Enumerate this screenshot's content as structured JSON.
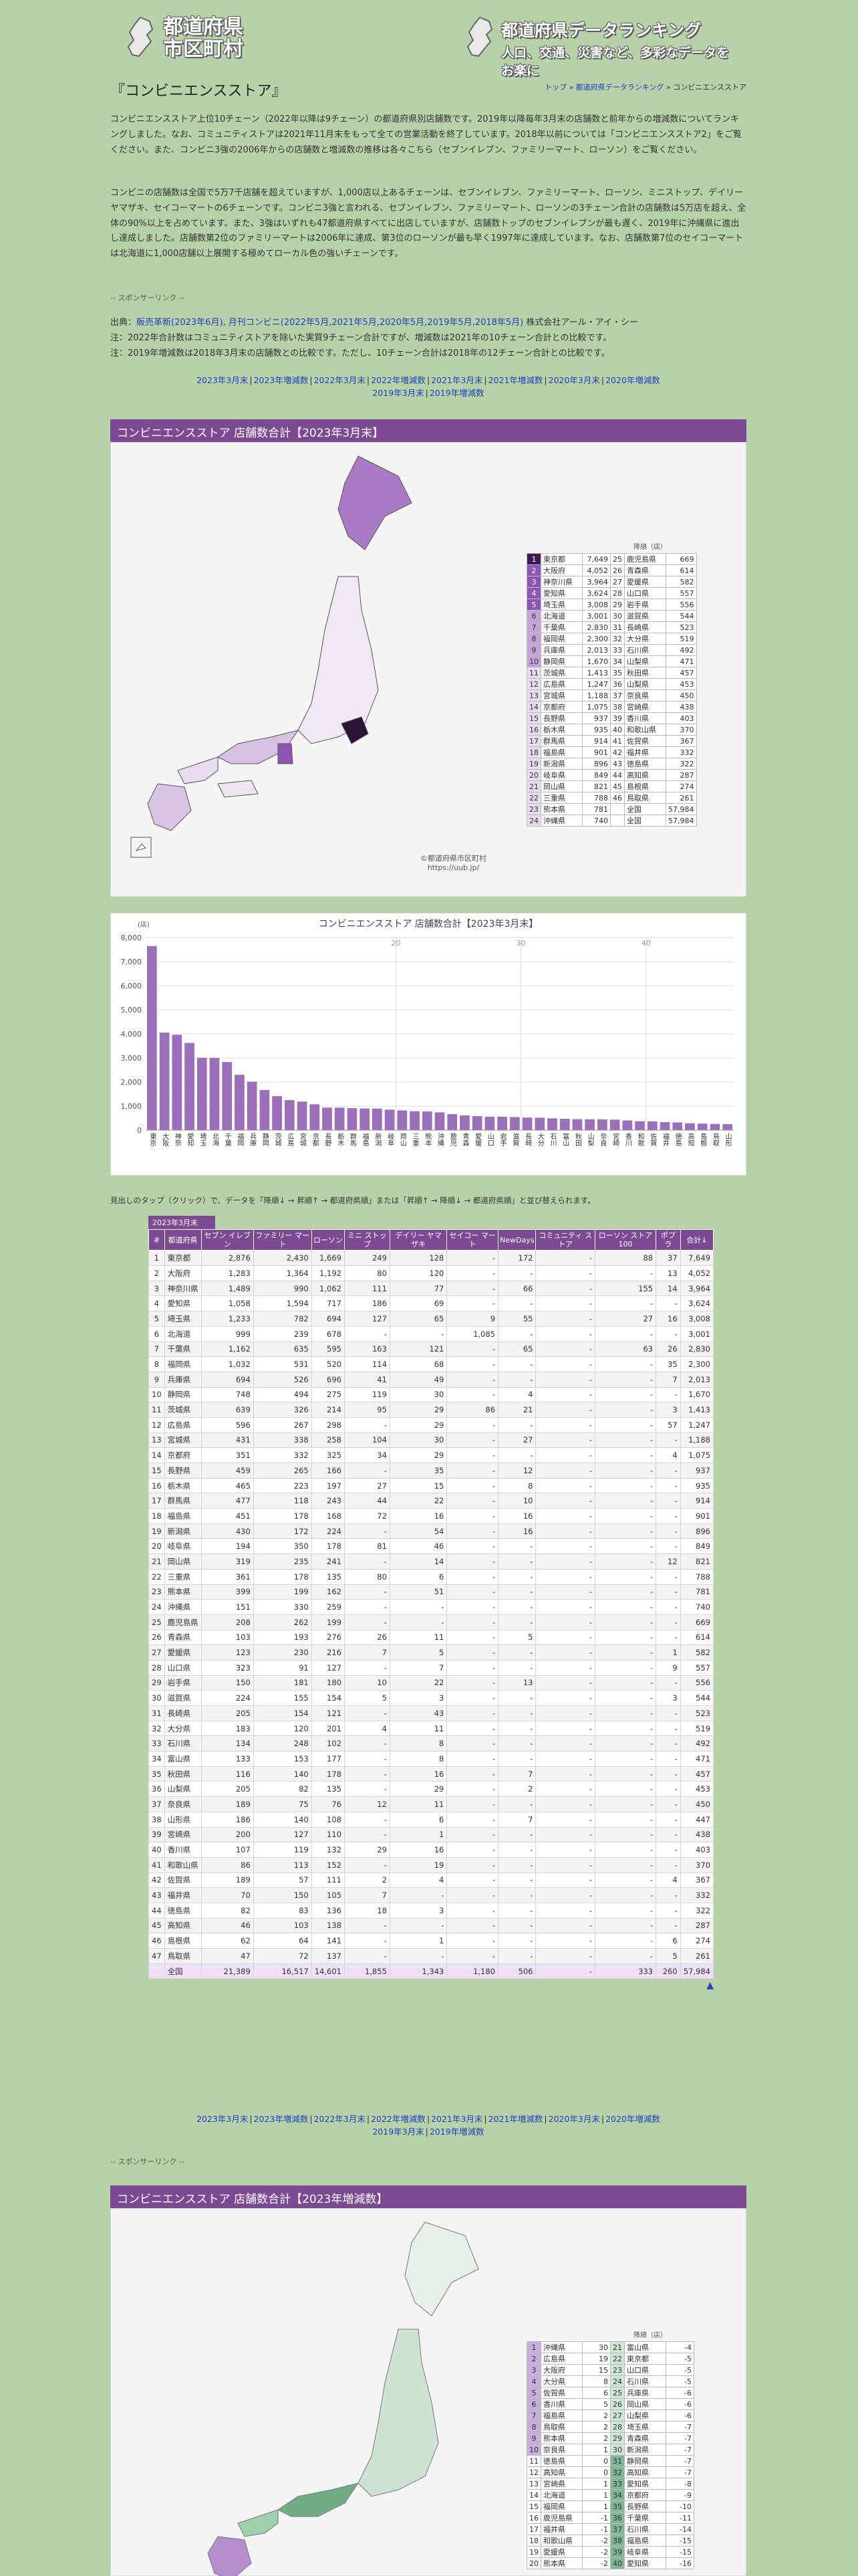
{
  "site": {
    "logo_left": [
      "都道府県",
      "市区町村"
    ],
    "logo_right_1": "都道府県データランキング",
    "logo_right_2": "人口、交通、災害など、多彩なデータをお楽に"
  },
  "page_title": "『コンビニエンスストア』",
  "breadcrumb": {
    "top": "トップ",
    "sep": " » ",
    "mid": "都道府県データランキング",
    "current": "コンビニエンスストア"
  },
  "intro1": "コンビニエンスストア上位10チェーン（2022年以降は9チェーン）の都道府県別店舗数です。2019年以降毎年3月末の店舗数と前年からの増減数についてランキングしました。なお、コミュニティストアは2021年11月末をもって全ての営業活動を終了しています。2018年以前については「コンビニエンスストア2」をご覧ください。また、コンビニ3強の2006年からの店舗数と増減数の推移は各々こちら（セブンイレブン、ファミリーマート、ローソン）をご覧ください。",
  "intro2": "コンビニの店舗数は全国で5万7千店舗を超えていますが、1,000店以上あるチェーンは、セブンイレブン、ファミリーマート、ローソン、ミニストップ、デイリーヤマザキ、セイコーマートの6チェーンです。コンビニ3強と言われる、セブンイレブン、ファミリーマート、ローソンの3チェーン合計の店舗数は5万店を超え、全体の90%以上を占めています。また、3強はいずれも47都道府県すべてに出店していますが、店舗数トップのセブンイレブンが最も遅く、2019年に沖縄県に進出し達成しました。店舗数第2位のファミリーマートは2006年に達成、第3位のローソンが最も早く1997年に達成しています。なお、店舗数第7位のセイコーマートは北海道に1,000店舗以上展開する極めてローカル色の強いチェーンです。",
  "sponsor": "-- スポンサーリンク --",
  "source_prefix": "出典：",
  "source_link": "販売革新(2023年6月), 月刊コンビニ(2022年5月,2021年5月,2020年5月,2019年5月,2018年5月)",
  "source_suffix": " 株式会社アール・アイ・シー",
  "note1": "注：2022年合計数はコミュニティストアを除いた実質9チェーン合計ですが、増減数は2021年の10チェーン合計との比較です。",
  "note2": "注：2019年増減数は2018年3月末の店舗数との比較です。ただし、10チェーン合計は2018年の12チェーン合計との比較です。",
  "links": [
    "2023年3月末",
    "2023年増減数",
    "2022年3月末",
    "2022年増減数",
    "2021年3月末",
    "2021年増減数",
    "2020年3月末",
    "2020年増減数",
    "2019年3月末",
    "2019年増減数"
  ],
  "section1_title": "コンビニエンスストア 店舗数合計【2023年3月末】",
  "section2_title": "コンビニエンスストア 店舗数合計【2023年増減数】",
  "map_legend_note": "降順（店）",
  "map_credit": [
    "©都道府県市区町村",
    "https://uub.jp/"
  ],
  "map1_total_label": "全国",
  "map1_total": "57,984",
  "rank1": [
    [
      "東京都",
      "7,649"
    ],
    [
      "大阪府",
      "4,052"
    ],
    [
      "神奈川県",
      "3,964"
    ],
    [
      "愛知県",
      "3,624"
    ],
    [
      "埼玉県",
      "3,008"
    ],
    [
      "北海道",
      "3,001"
    ],
    [
      "千葉県",
      "2,830"
    ],
    [
      "福岡県",
      "2,300"
    ],
    [
      "兵庫県",
      "2,013"
    ],
    [
      "静岡県",
      "1,670"
    ],
    [
      "茨城県",
      "1,413"
    ],
    [
      "広島県",
      "1,247"
    ],
    [
      "宮城県",
      "1,188"
    ],
    [
      "京都府",
      "1,075"
    ],
    [
      "長野県",
      "937"
    ],
    [
      "栃木県",
      "935"
    ],
    [
      "群馬県",
      "914"
    ],
    [
      "福島県",
      "901"
    ],
    [
      "新潟県",
      "896"
    ],
    [
      "岐阜県",
      "849"
    ],
    [
      "岡山県",
      "821"
    ],
    [
      "三重県",
      "788"
    ],
    [
      "熊本県",
      "781"
    ],
    [
      "沖縄県",
      "740"
    ],
    [
      "鹿児島県",
      "669"
    ],
    [
      "青森県",
      "614"
    ],
    [
      "愛媛県",
      "582"
    ],
    [
      "山口県",
      "557"
    ],
    [
      "岩手県",
      "556"
    ],
    [
      "滋賀県",
      "544"
    ],
    [
      "長崎県",
      "523"
    ],
    [
      "大分県",
      "519"
    ],
    [
      "石川県",
      "492"
    ],
    [
      "山梨県",
      "471"
    ],
    [
      "秋田県",
      "457"
    ],
    [
      "山梨県",
      "453"
    ],
    [
      "奈良県",
      "450"
    ],
    [
      "宮崎県",
      "438"
    ],
    [
      "香川県",
      "403"
    ],
    [
      "和歌山県",
      "370"
    ],
    [
      "佐賀県",
      "367"
    ],
    [
      "福井県",
      "332"
    ],
    [
      "徳島県",
      "322"
    ],
    [
      "高知県",
      "287"
    ],
    [
      "島根県",
      "274"
    ],
    [
      "鳥取県",
      "261"
    ]
  ],
  "rank2": [
    [
      "沖縄県",
      "30"
    ],
    [
      "広島県",
      "19"
    ],
    [
      "大阪府",
      "15"
    ],
    [
      "大分県",
      "8"
    ],
    [
      "佐賀県",
      "6"
    ],
    [
      "香川県",
      "5"
    ],
    [
      "福島県",
      "2"
    ],
    [
      "鳥取県",
      "2"
    ],
    [
      "熊本県",
      "2"
    ],
    [
      "奈良県",
      "1"
    ],
    [
      "徳島県",
      "0"
    ],
    [
      "高知県",
      "0"
    ],
    [
      "宮崎県",
      "1"
    ],
    [
      "北海道",
      "1"
    ],
    [
      "福岡県",
      "1"
    ],
    [
      "鹿児島県",
      "-1"
    ],
    [
      "福井県",
      "-1"
    ],
    [
      "和歌山県",
      "-2"
    ],
    [
      "愛媛県",
      "-2"
    ],
    [
      "熊本県",
      "-2"
    ],
    [
      "富山県",
      "-4"
    ],
    [
      "東京都",
      "-5"
    ],
    [
      "山口県",
      "-5"
    ],
    [
      "石川県",
      "-5"
    ],
    [
      "兵庫県",
      "-6"
    ],
    [
      "岡山県",
      "-6"
    ],
    [
      "山梨県",
      "-6"
    ],
    [
      "埼玉県",
      "-7"
    ],
    [
      "青森県",
      "-7"
    ],
    [
      "新潟県",
      "-7"
    ],
    [
      "静岡県",
      "-7"
    ],
    [
      "高知県",
      "-7"
    ],
    [
      "愛知県",
      "-8"
    ],
    [
      "京都府",
      "-9"
    ],
    [
      "長野県",
      "-10"
    ],
    [
      "千葉県",
      "-11"
    ],
    [
      "石川県",
      "-14"
    ],
    [
      "福島県",
      "-15"
    ],
    [
      "岐阜県",
      "-15"
    ],
    [
      "愛知県",
      "-16"
    ]
  ],
  "chart1": {
    "chart_data": {
      "type": "bar",
      "title": "コンビニエンスストア 店舗数合計【2023年3月末】",
      "ylabel": "(店)",
      "ylim": [
        0,
        8000
      ],
      "yticks": [
        "0",
        "1,000",
        "2,000",
        "3,000",
        "4,000",
        "5,000",
        "6,000",
        "7,000",
        "8,000"
      ],
      "topticks": [
        "20",
        "30",
        "40"
      ],
      "categories": [
        "東京",
        "大阪",
        "神奈",
        "愛知",
        "埼玉",
        "北海",
        "千葉",
        "福岡",
        "兵庫",
        "静岡",
        "茨城",
        "広島",
        "宮城",
        "京都",
        "長野",
        "栃木",
        "群馬",
        "福島",
        "新潟",
        "岐阜",
        "岡山",
        "三重",
        "熊本",
        "沖縄",
        "鹿児",
        "青森",
        "愛媛",
        "山口",
        "岩手",
        "滋賀",
        "長崎",
        "大分",
        "石川",
        "富山",
        "秋田",
        "山梨",
        "奈良",
        "宮崎",
        "香川",
        "和歌",
        "佐賀",
        "福井",
        "徳島",
        "高知",
        "島根",
        "鳥取",
        "山形"
      ],
      "values": [
        7649,
        4052,
        3964,
        3624,
        3008,
        3001,
        2830,
        2300,
        2013,
        1670,
        1413,
        1247,
        1188,
        1075,
        937,
        935,
        914,
        901,
        896,
        849,
        821,
        788,
        781,
        740,
        669,
        614,
        582,
        557,
        556,
        544,
        523,
        519,
        492,
        471,
        457,
        453,
        450,
        438,
        403,
        370,
        367,
        332,
        322,
        287,
        274,
        261,
        250
      ],
      "colors": {
        "bar": "#9b6fb9",
        "grid": "#dddddd"
      }
    }
  },
  "table_intro": "見出しのタップ（クリック）で、データを「降順↓ → 昇順↑ → 都道府県順」または「昇順↑ → 降順↓ → 都道府県順」と並び替えられます。",
  "table_caption": "2023年3月末",
  "table_headers": [
    "#",
    "都道府県",
    "セブン イレブン",
    "ファミリー マート",
    "ローソン",
    "ミニ ストップ",
    "デイリー ヤマザキ",
    "セイコー マート",
    "NewDays",
    "コミュニティ ストア",
    "ローソン ストア100",
    "ポプラ",
    "合計↓"
  ],
  "table_rows": [
    [
      "1",
      "東京都",
      "2,876",
      "2,430",
      "1,669",
      "249",
      "128",
      "-",
      "172",
      "-",
      "88",
      "37",
      "7,649"
    ],
    [
      "2",
      "大阪府",
      "1,283",
      "1,364",
      "1,192",
      "80",
      "120",
      "-",
      "-",
      "-",
      "-",
      "13",
      "4,052"
    ],
    [
      "3",
      "神奈川県",
      "1,489",
      "990",
      "1,062",
      "111",
      "77",
      "-",
      "66",
      "-",
      "155",
      "14",
      "3,964"
    ],
    [
      "4",
      "愛知県",
      "1,058",
      "1,594",
      "717",
      "186",
      "69",
      "-",
      "-",
      "-",
      "-",
      "-",
      "3,624"
    ],
    [
      "5",
      "埼玉県",
      "1,233",
      "782",
      "694",
      "127",
      "65",
      "9",
      "55",
      "-",
      "27",
      "16",
      "3,008"
    ],
    [
      "6",
      "北海道",
      "999",
      "239",
      "678",
      "-",
      "-",
      "1,085",
      "-",
      "-",
      "-",
      "-",
      "3,001"
    ],
    [
      "7",
      "千葉県",
      "1,162",
      "635",
      "595",
      "163",
      "121",
      "-",
      "65",
      "-",
      "63",
      "26",
      "2,830"
    ],
    [
      "8",
      "福岡県",
      "1,032",
      "531",
      "520",
      "114",
      "68",
      "-",
      "-",
      "-",
      "-",
      "35",
      "2,300"
    ],
    [
      "9",
      "兵庫県",
      "694",
      "526",
      "696",
      "41",
      "49",
      "-",
      "-",
      "-",
      "-",
      "7",
      "2,013"
    ],
    [
      "10",
      "静岡県",
      "748",
      "494",
      "275",
      "119",
      "30",
      "-",
      "4",
      "-",
      "-",
      "-",
      "1,670"
    ],
    [
      "11",
      "茨城県",
      "639",
      "326",
      "214",
      "95",
      "29",
      "86",
      "21",
      "-",
      "-",
      "3",
      "1,413"
    ],
    [
      "12",
      "広島県",
      "596",
      "267",
      "298",
      "-",
      "29",
      "-",
      "-",
      "-",
      "-",
      "57",
      "1,247"
    ],
    [
      "13",
      "宮城県",
      "431",
      "338",
      "258",
      "104",
      "30",
      "-",
      "27",
      "-",
      "-",
      "-",
      "1,188"
    ],
    [
      "14",
      "京都府",
      "351",
      "332",
      "325",
      "34",
      "29",
      "-",
      "-",
      "-",
      "-",
      "4",
      "1,075"
    ],
    [
      "15",
      "長野県",
      "459",
      "265",
      "166",
      "-",
      "35",
      "-",
      "12",
      "-",
      "-",
      "-",
      "937"
    ],
    [
      "16",
      "栃木県",
      "465",
      "223",
      "197",
      "27",
      "15",
      "-",
      "8",
      "-",
      "-",
      "-",
      "935"
    ],
    [
      "17",
      "群馬県",
      "477",
      "118",
      "243",
      "44",
      "22",
      "-",
      "10",
      "-",
      "-",
      "-",
      "914"
    ],
    [
      "18",
      "福島県",
      "451",
      "178",
      "168",
      "72",
      "16",
      "-",
      "16",
      "-",
      "-",
      "-",
      "901"
    ],
    [
      "19",
      "新潟県",
      "430",
      "172",
      "224",
      "-",
      "54",
      "-",
      "16",
      "-",
      "-",
      "-",
      "896"
    ],
    [
      "20",
      "岐阜県",
      "194",
      "350",
      "178",
      "81",
      "46",
      "-",
      "-",
      "-",
      "-",
      "-",
      "849"
    ],
    [
      "21",
      "岡山県",
      "319",
      "235",
      "241",
      "-",
      "14",
      "-",
      "-",
      "-",
      "-",
      "12",
      "821"
    ],
    [
      "22",
      "三重県",
      "361",
      "178",
      "135",
      "80",
      "6",
      "-",
      "-",
      "-",
      "-",
      "-",
      "788"
    ],
    [
      "23",
      "熊本県",
      "399",
      "199",
      "162",
      "-",
      "51",
      "-",
      "-",
      "-",
      "-",
      "-",
      "781"
    ],
    [
      "24",
      "沖縄県",
      "151",
      "330",
      "259",
      "-",
      "-",
      "-",
      "-",
      "-",
      "-",
      "-",
      "740"
    ],
    [
      "25",
      "鹿児島県",
      "208",
      "262",
      "199",
      "-",
      "-",
      "-",
      "-",
      "-",
      "-",
      "-",
      "669"
    ],
    [
      "26",
      "青森県",
      "103",
      "193",
      "276",
      "26",
      "11",
      "-",
      "5",
      "-",
      "-",
      "-",
      "614"
    ],
    [
      "27",
      "愛媛県",
      "123",
      "230",
      "216",
      "7",
      "5",
      "-",
      "-",
      "-",
      "-",
      "1",
      "582"
    ],
    [
      "28",
      "山口県",
      "323",
      "91",
      "127",
      "-",
      "7",
      "-",
      "-",
      "-",
      "-",
      "9",
      "557"
    ],
    [
      "29",
      "岩手県",
      "150",
      "181",
      "180",
      "10",
      "22",
      "-",
      "13",
      "-",
      "-",
      "-",
      "556"
    ],
    [
      "30",
      "滋賀県",
      "224",
      "155",
      "154",
      "5",
      "3",
      "-",
      "-",
      "-",
      "-",
      "3",
      "544"
    ],
    [
      "31",
      "長崎県",
      "205",
      "154",
      "121",
      "-",
      "43",
      "-",
      "-",
      "-",
      "-",
      "-",
      "523"
    ],
    [
      "32",
      "大分県",
      "183",
      "120",
      "201",
      "4",
      "11",
      "-",
      "-",
      "-",
      "-",
      "-",
      "519"
    ],
    [
      "33",
      "石川県",
      "134",
      "248",
      "102",
      "-",
      "8",
      "-",
      "-",
      "-",
      "-",
      "-",
      "492"
    ],
    [
      "34",
      "富山県",
      "133",
      "153",
      "177",
      "-",
      "8",
      "-",
      "-",
      "-",
      "-",
      "-",
      "471"
    ],
    [
      "35",
      "秋田県",
      "116",
      "140",
      "178",
      "-",
      "16",
      "-",
      "7",
      "-",
      "-",
      "-",
      "457"
    ],
    [
      "36",
      "山梨県",
      "205",
      "82",
      "135",
      "-",
      "29",
      "-",
      "2",
      "-",
      "-",
      "-",
      "453"
    ],
    [
      "37",
      "奈良県",
      "189",
      "75",
      "76",
      "12",
      "11",
      "-",
      "-",
      "-",
      "-",
      "-",
      "450"
    ],
    [
      "38",
      "山形県",
      "186",
      "140",
      "108",
      "-",
      "6",
      "-",
      "7",
      "-",
      "-",
      "-",
      "447"
    ],
    [
      "39",
      "宮崎県",
      "200",
      "127",
      "110",
      "-",
      "1",
      "-",
      "-",
      "-",
      "-",
      "-",
      "438"
    ],
    [
      "40",
      "香川県",
      "107",
      "119",
      "132",
      "29",
      "16",
      "-",
      "-",
      "-",
      "-",
      "-",
      "403"
    ],
    [
      "41",
      "和歌山県",
      "86",
      "113",
      "152",
      "-",
      "19",
      "-",
      "-",
      "-",
      "-",
      "-",
      "370"
    ],
    [
      "42",
      "佐賀県",
      "189",
      "57",
      "111",
      "2",
      "4",
      "-",
      "-",
      "-",
      "-",
      "4",
      "367"
    ],
    [
      "43",
      "福井県",
      "70",
      "150",
      "105",
      "7",
      "-",
      "-",
      "-",
      "-",
      "-",
      "-",
      "332"
    ],
    [
      "44",
      "徳島県",
      "82",
      "83",
      "136",
      "18",
      "3",
      "-",
      "-",
      "-",
      "-",
      "-",
      "322"
    ],
    [
      "45",
      "高知県",
      "46",
      "103",
      "138",
      "-",
      "-",
      "-",
      "-",
      "-",
      "-",
      "-",
      "287"
    ],
    [
      "46",
      "島根県",
      "62",
      "64",
      "141",
      "-",
      "1",
      "-",
      "-",
      "-",
      "-",
      "6",
      "274"
    ],
    [
      "47",
      "鳥取県",
      "47",
      "72",
      "137",
      "-",
      "-",
      "-",
      "-",
      "-",
      "-",
      "5",
      "261"
    ]
  ],
  "table_total": [
    "",
    "全国",
    "21,389",
    "16,517",
    "14,601",
    "1,855",
    "1,343",
    "1,180",
    "506",
    "-",
    "333",
    "260",
    "57,984"
  ],
  "up_arrow": "▲"
}
